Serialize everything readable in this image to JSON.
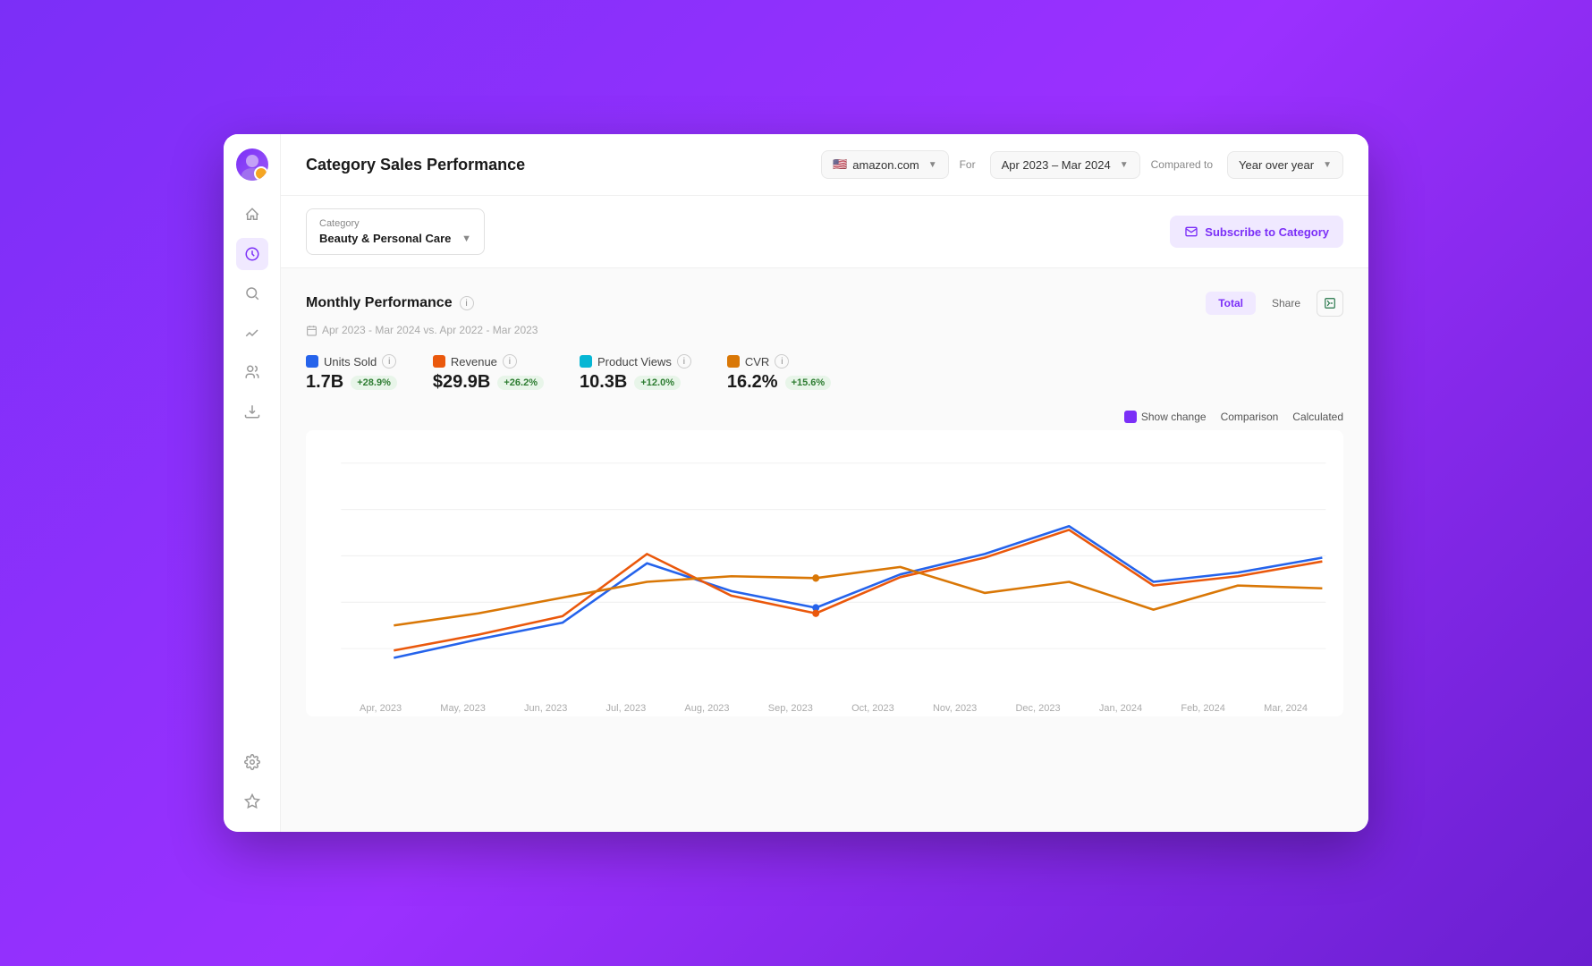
{
  "app": {
    "title": "Category Sales Performance"
  },
  "header": {
    "store": "amazon.com",
    "for_label": "For",
    "date_range": "Apr 2023 – Mar 2024",
    "compared_to_label": "Compared to",
    "comparison": "Year over year"
  },
  "filter": {
    "category_label": "Category",
    "category_value": "Beauty & Personal Care",
    "subscribe_label": "Subscribe to Category"
  },
  "monthly_performance": {
    "title": "Monthly Performance",
    "date_range": "Apr 2023 - Mar 2024 vs. Apr 2022 - Mar 2023",
    "tabs": [
      "Total",
      "Share"
    ],
    "active_tab": "Total",
    "metrics": [
      {
        "id": "units_sold",
        "label": "Units Sold",
        "value": "1.7B",
        "badge": "+28.9%",
        "color": "#2563eb"
      },
      {
        "id": "revenue",
        "label": "Revenue",
        "value": "$29.9B",
        "badge": "+26.2%",
        "color": "#ea580c"
      },
      {
        "id": "product_views",
        "label": "Product Views",
        "value": "10.3B",
        "badge": "+12.0%",
        "color": "#06b6d4"
      },
      {
        "id": "cvr",
        "label": "CVR",
        "value": "16.2%",
        "badge": "+15.6%",
        "color": "#d97706"
      }
    ],
    "show_change_label": "Show change",
    "comparison_label": "Comparison",
    "calculated_label": "Calculated"
  },
  "chart": {
    "x_labels": [
      "Apr, 2023",
      "May, 2023",
      "Jun, 2023",
      "Jul, 2023",
      "Aug, 2023",
      "Sep, 2023",
      "Oct, 2023",
      "Nov, 2023",
      "Dec, 2023",
      "Jan, 2024",
      "Feb, 2024",
      "Mar, 2024"
    ],
    "series": {
      "blue": [
        10,
        18,
        28,
        62,
        45,
        30,
        56,
        72,
        95,
        52,
        62,
        75
      ],
      "orange": [
        15,
        20,
        32,
        68,
        42,
        28,
        55,
        70,
        92,
        50,
        60,
        72
      ],
      "yellow": [
        30,
        38,
        50,
        60,
        65,
        62,
        75,
        60,
        70,
        50,
        65,
        60
      ]
    }
  },
  "sidebar": {
    "icons": [
      "🚀",
      "📊",
      "🔍",
      "↗",
      "👥",
      "📥"
    ]
  }
}
